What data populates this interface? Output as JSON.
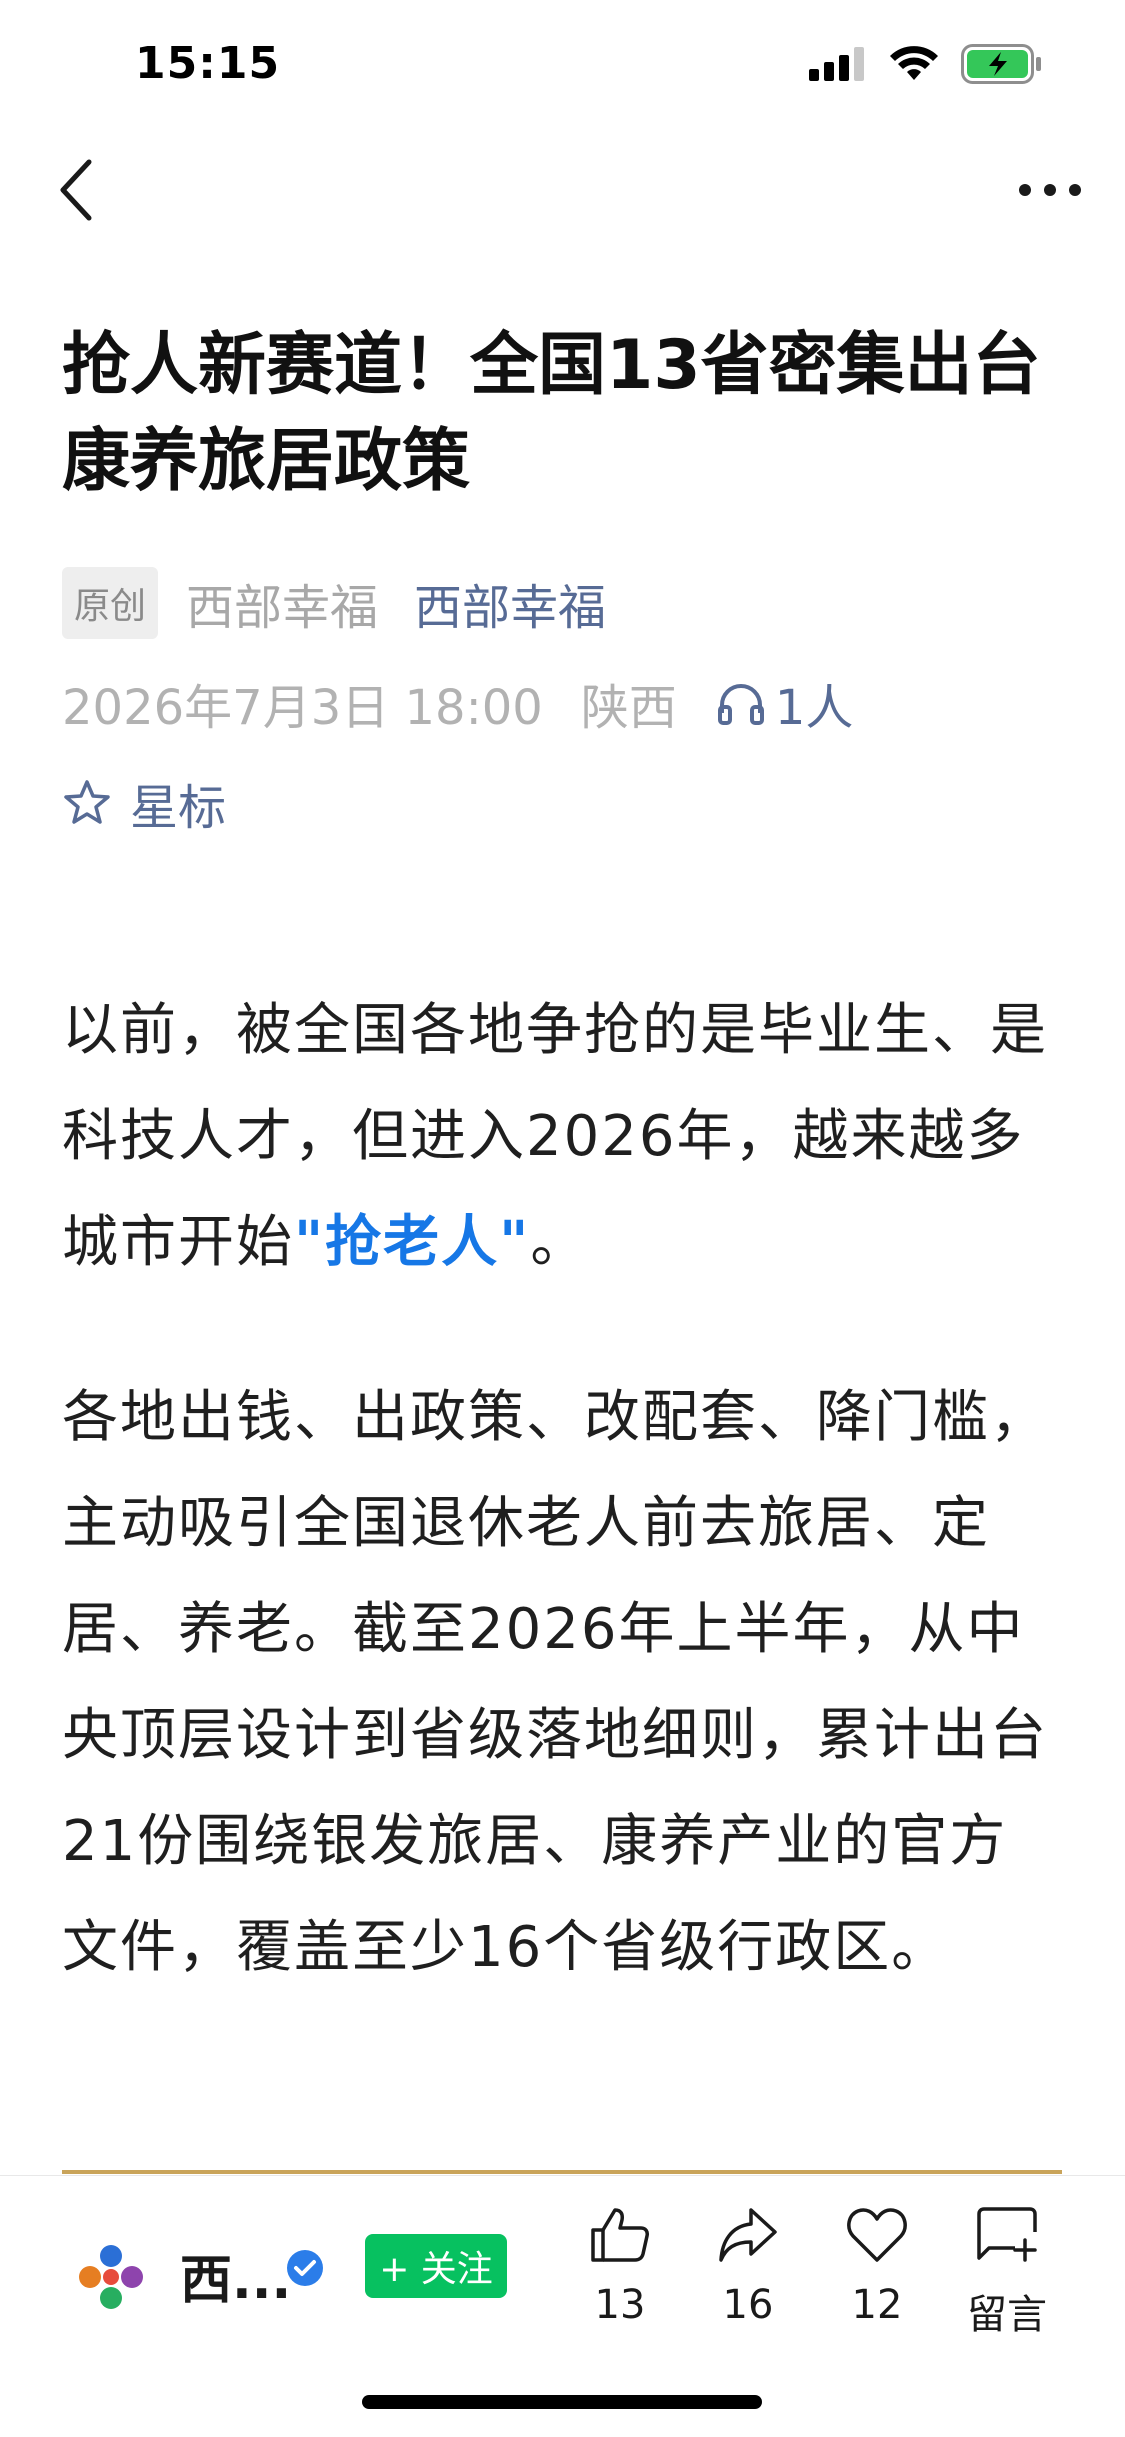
{
  "status_bar": {
    "time": "15:15"
  },
  "article": {
    "title": "抢人新赛道！全国13省密集出台康养旅居政策",
    "tag": "原创",
    "author_plain": "西部幸福",
    "author_link": "西部幸福",
    "date": "2026年7月3日 18:00",
    "location": "陕西",
    "listeners": "1人",
    "star_label": "星标",
    "p1_text": "以前，被全国各地争抢的是毕业生、是科技人才，但进入2026年，越来越多城市开始",
    "p1_highlight": "\"抢老人\"",
    "p1_tail": "。",
    "p2_text": "各地出钱、出政策、改配套、降门槛，主动吸引全国退休老人前去旅居、定居、养老。截至2026年上半年，从中央顶层设计到省级落地细则，累计出台21份围绕银发旅居、康养产业的官方文件，覆盖至少16个省级行政区。"
  },
  "bottom_bar": {
    "account_name": "西...",
    "follow_label": "+ 关注",
    "like_count": "13",
    "share_count": "16",
    "heart_count": "12",
    "comment_label": "留言"
  },
  "colors": {
    "accent_blue": "#576b95",
    "highlight_blue": "#1677e6",
    "follow_green": "#07c160",
    "battery_green": "#34c759"
  },
  "icons": [
    "back-arrow-icon",
    "more-icon",
    "headphones-icon",
    "star-icon",
    "thumbs-up-icon",
    "share-icon",
    "heart-icon",
    "comment-icon",
    "verified-icon",
    "signal-icon",
    "wifi-icon",
    "battery-icon"
  ]
}
